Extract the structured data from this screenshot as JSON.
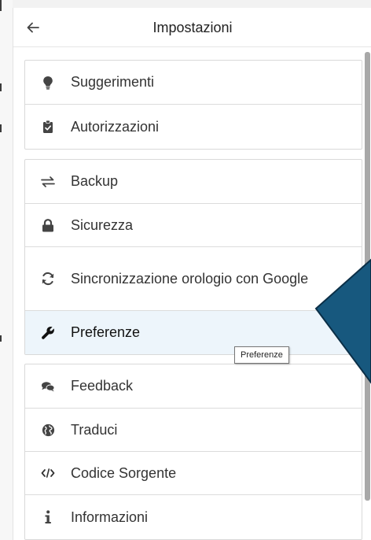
{
  "header": {
    "title": "Impostazioni",
    "back_icon": "arrow-left-icon"
  },
  "groups": [
    {
      "items": [
        {
          "label": "Suggerimenti",
          "icon": "lightbulb-icon"
        },
        {
          "label": "Autorizzazioni",
          "icon": "clipboard-check-icon"
        }
      ]
    },
    {
      "items": [
        {
          "label": "Backup",
          "icon": "exchange-icon"
        },
        {
          "label": "Sicurezza",
          "icon": "lock-icon"
        },
        {
          "label": "Sincronizzazione orologio con Google",
          "icon": "sync-icon"
        },
        {
          "label": "Preferenze",
          "icon": "wrench-icon",
          "active": true
        }
      ]
    },
    {
      "items": [
        {
          "label": "Feedback",
          "icon": "comments-icon"
        },
        {
          "label": "Traduci",
          "icon": "globe-icon"
        },
        {
          "label": "Codice Sorgente",
          "icon": "code-icon"
        },
        {
          "label": "Informazioni",
          "icon": "info-icon"
        }
      ]
    }
  ],
  "tooltip": {
    "text": "Preferenze"
  },
  "colors": {
    "icon": "#444444",
    "text": "#333333",
    "active_bg": "#edf5fb",
    "annotation_fill": "#17587e",
    "annotation_stroke": "#0b2f47"
  }
}
